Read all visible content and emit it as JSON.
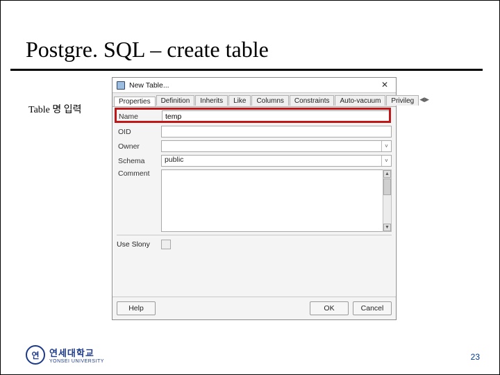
{
  "slide": {
    "title": "Postgre. SQL – create table",
    "note": "Table 명 입력",
    "page_number": "23"
  },
  "logo": {
    "korean": "연세대학교",
    "english": "YONSEI UNIVERSITY"
  },
  "dialog": {
    "title": "New Table...",
    "close": "✕",
    "tabs": {
      "nav_left": "◀",
      "items": [
        {
          "label": "Properties",
          "active": true
        },
        {
          "label": "Definition",
          "active": false
        },
        {
          "label": "Inherits",
          "active": false
        },
        {
          "label": "Like",
          "active": false
        },
        {
          "label": "Columns",
          "active": false
        },
        {
          "label": "Constraints",
          "active": false
        },
        {
          "label": "Auto-vacuum",
          "active": false
        },
        {
          "label": "Privileg",
          "active": false
        }
      ],
      "nav_right": "▶"
    },
    "fields": {
      "name": {
        "label": "Name",
        "value": "temp"
      },
      "oid": {
        "label": "OID",
        "value": ""
      },
      "owner": {
        "label": "Owner",
        "value": ""
      },
      "schema": {
        "label": "Schema",
        "value": "public"
      },
      "comment": {
        "label": "Comment",
        "value": ""
      },
      "use_slony": {
        "label": "Use Slony"
      }
    },
    "buttons": {
      "help": "Help",
      "ok": "OK",
      "cancel": "Cancel"
    }
  }
}
